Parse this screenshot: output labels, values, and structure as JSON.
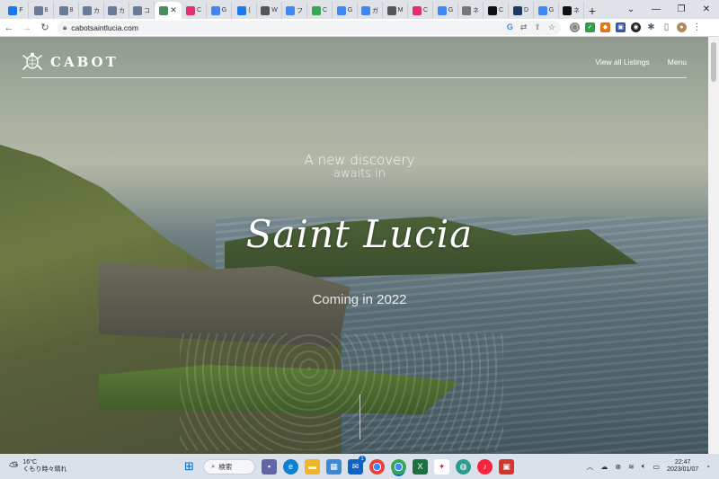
{
  "browser": {
    "tabs": [
      {
        "letter": "F",
        "color": "#1877f2",
        "icon": "facebook-icon"
      },
      {
        "letter": "8",
        "color": "#6b7a99",
        "icon": "page-icon"
      },
      {
        "letter": "8",
        "color": "#6b7a99",
        "icon": "page-icon"
      },
      {
        "letter": "カ",
        "color": "#6b7a99",
        "icon": "page-icon"
      },
      {
        "letter": "カ",
        "color": "#6b7a99",
        "icon": "page-icon"
      },
      {
        "letter": "コ",
        "color": "#6b7a99",
        "icon": "page-icon"
      },
      {
        "letter": "",
        "color": "#4a8f5a",
        "icon": "cabot-icon",
        "active": true
      },
      {
        "letter": "C",
        "color": "#e1306c",
        "icon": "instagram-icon"
      },
      {
        "letter": "G",
        "color": "#4285f4",
        "icon": "google-icon"
      },
      {
        "letter": "(",
        "color": "#1877f2",
        "icon": "facebook-icon"
      },
      {
        "letter": "W",
        "color": "#555555",
        "icon": "wikipedia-icon"
      },
      {
        "letter": "フ",
        "color": "#4285f4",
        "icon": "google-icon"
      },
      {
        "letter": "C",
        "color": "#34a853",
        "icon": "maps-icon"
      },
      {
        "letter": "G",
        "color": "#4285f4",
        "icon": "google-icon"
      },
      {
        "letter": "ガ",
        "color": "#4285f4",
        "icon": "google-icon"
      },
      {
        "letter": "M",
        "color": "#555555",
        "icon": "page-icon"
      },
      {
        "letter": "C",
        "color": "#e1306c",
        "icon": "instagram-icon"
      },
      {
        "letter": "G",
        "color": "#4285f4",
        "icon": "google-icon"
      },
      {
        "letter": "ネ",
        "color": "#777777",
        "icon": "page-icon"
      },
      {
        "letter": "C",
        "color": "#111111",
        "icon": "page-icon"
      },
      {
        "letter": "D",
        "color": "#1e3a5f",
        "icon": "page-icon"
      },
      {
        "letter": "G",
        "color": "#4285f4",
        "icon": "google-icon"
      },
      {
        "letter": "ネ",
        "color": "#111111",
        "icon": "page-icon"
      }
    ],
    "new_tab": "+",
    "url": "cabotsaintlucia.com"
  },
  "site": {
    "logo": "CABOT",
    "nav": {
      "listings": "View all Listings",
      "menu": "Menu"
    },
    "hero": {
      "line1": "A new discovery",
      "line2": "awaits in",
      "place": "Saint Lucia",
      "coming": "Coming in 2022"
    }
  },
  "taskbar": {
    "weather_temp": "16°C",
    "weather_desc": "くもり時々晴れ",
    "search_label": "検索",
    "time": "22:47",
    "date": "2023/01/07",
    "mail_badge": "1"
  },
  "colors": {
    "taskbar_bg": "#dbe1ea",
    "tabstrip_bg": "#dfe3e8",
    "hero_text": "#ffffff"
  }
}
